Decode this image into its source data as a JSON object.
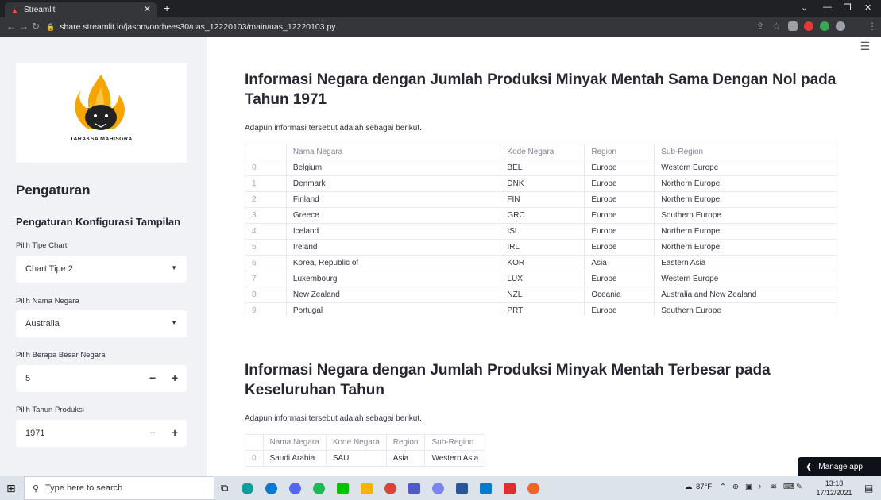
{
  "browser": {
    "tab_title": "Streamlit",
    "url": "share.streamlit.io/jasonvoorhees30/uas_12220103/main/uas_12220103.py"
  },
  "sidebar": {
    "logo_caption": "TARAKSA MAHISGRA",
    "heading": "Pengaturan",
    "subheading": "Pengaturan Konfigurasi Tampilan",
    "chart_type_label": "Pilih Tipe Chart",
    "chart_type_value": "Chart Tipe 2",
    "country_label": "Pilih Nama Negara",
    "country_value": "Australia",
    "size_label": "Pilih Berapa Besar Negara",
    "size_value": "5",
    "year_label": "Pilih Tahun Produksi",
    "year_value": "1971"
  },
  "section1": {
    "title": "Informasi Negara dengan Jumlah Produksi Minyak Mentah Sama Dengan Nol pada Tahun 1971",
    "intro": "Adapun informasi tersebut adalah sebagai berikut.",
    "columns": [
      "Nama Negara",
      "Kode Negara",
      "Region",
      "Sub-Region"
    ],
    "rows": [
      [
        "0",
        "Belgium",
        "BEL",
        "Europe",
        "Western Europe"
      ],
      [
        "1",
        "Denmark",
        "DNK",
        "Europe",
        "Northern Europe"
      ],
      [
        "2",
        "Finland",
        "FIN",
        "Europe",
        "Northern Europe"
      ],
      [
        "3",
        "Greece",
        "GRC",
        "Europe",
        "Southern Europe"
      ],
      [
        "4",
        "Iceland",
        "ISL",
        "Europe",
        "Northern Europe"
      ],
      [
        "5",
        "Ireland",
        "IRL",
        "Europe",
        "Northern Europe"
      ],
      [
        "6",
        "Korea, Republic of",
        "KOR",
        "Asia",
        "Eastern Asia"
      ],
      [
        "7",
        "Luxembourg",
        "LUX",
        "Europe",
        "Western Europe"
      ],
      [
        "8",
        "New Zealand",
        "NZL",
        "Oceania",
        "Australia and New Zealand"
      ],
      [
        "9",
        "Portugal",
        "PRT",
        "Europe",
        "Southern Europe"
      ]
    ]
  },
  "section2": {
    "title": "Informasi Negara dengan Jumlah Produksi Minyak Mentah Terbesar pada Keseluruhan Tahun",
    "intro": "Adapun informasi tersebut adalah sebagai berikut.",
    "columns": [
      "Nama Negara",
      "Kode Negara",
      "Region",
      "Sub-Region"
    ],
    "rows": [
      [
        "0",
        "Saudi Arabia",
        "SAU",
        "Asia",
        "Western Asia"
      ]
    ]
  },
  "manage_app_label": "Manage app",
  "taskbar": {
    "search_placeholder": "Type here to search",
    "weather": "87°F",
    "time": "13:18",
    "date": "17/12/2021"
  }
}
